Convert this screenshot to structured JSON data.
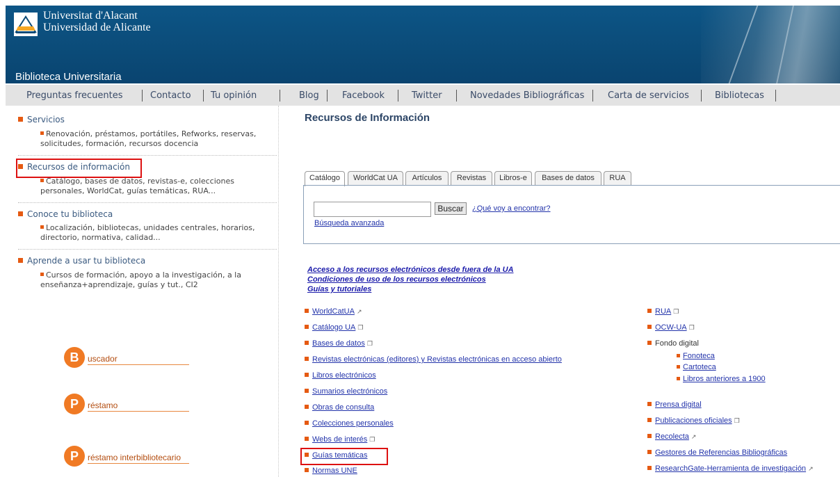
{
  "header": {
    "university_line1": "Universitat d'Alacant",
    "university_line2": "Universidad de Alicante",
    "section_title": "Biblioteca Universitaria"
  },
  "nav": [
    "Preguntas frecuentes",
    "Contacto",
    "Tu opinión",
    "Blog",
    "Facebook",
    "Twitter",
    "Novedades Bibliográficas",
    "Carta de servicios",
    "Bibliotecas"
  ],
  "sidebar": {
    "sections": [
      {
        "title": "Servicios",
        "desc": "Renovación, préstamos, portátiles, Refworks, reservas, solicitudes, formación, recursos docencia"
      },
      {
        "title": "Recursos de información",
        "desc": "Catálogo, bases de datos, revistas-e, colecciones personales, WorldCat, guías temáticas, RUA..."
      },
      {
        "title": "Conoce tu biblioteca",
        "desc": "Localización, bibliotecas, unidades centrales, horarios, directorio, normativa, calidad..."
      },
      {
        "title": "Aprende a usar tu biblioteca",
        "desc": "Cursos de formación, apoyo a la investigación, a la enseñanza+aprendizaje, guías y tut., CI2"
      }
    ],
    "promos": [
      {
        "letter": "B",
        "text": "uscador"
      },
      {
        "letter": "P",
        "text": "réstamo"
      },
      {
        "letter": "P",
        "text": "réstamo interbibliotecario"
      }
    ]
  },
  "main": {
    "title": "Recursos de Información",
    "tabs": [
      "Catálogo",
      "WorldCat UA",
      "Artículos",
      "Revistas",
      "Libros-e",
      "Bases de datos",
      "RUA"
    ],
    "search": {
      "value": "",
      "button": "Buscar",
      "help_link": "¿Qué voy a encontrar?",
      "advanced_link": "Búsqueda avanzada"
    },
    "access_links": [
      "Acceso a los recursos electrónicos desde fuera de la UA",
      "Condiciones de uso de los recursos electrónicos",
      "Guías y tutoriales"
    ],
    "resources_left": [
      "WorldCatUA",
      "Catálogo UA",
      "Bases de datos",
      "Revistas electrónicas (editores) y Revistas electrónicas en acceso abierto",
      "Libros electrónicos",
      "Sumarios electrónicos",
      "Obras de consulta",
      "Colecciones personales",
      "Webs de interés",
      "Guías temáticas",
      "Normas UNE"
    ],
    "resources_right": [
      "RUA",
      "OCW-UA",
      "Fondo digital",
      "Fonoteca",
      "Cartoteca",
      "Libros anteriores a 1900",
      "Prensa digital",
      "Publicaciones oficiales",
      "Recolecta",
      "Gestores de Referencias Bibliográficas",
      "ResearchGate-Herramienta de investigación"
    ]
  }
}
